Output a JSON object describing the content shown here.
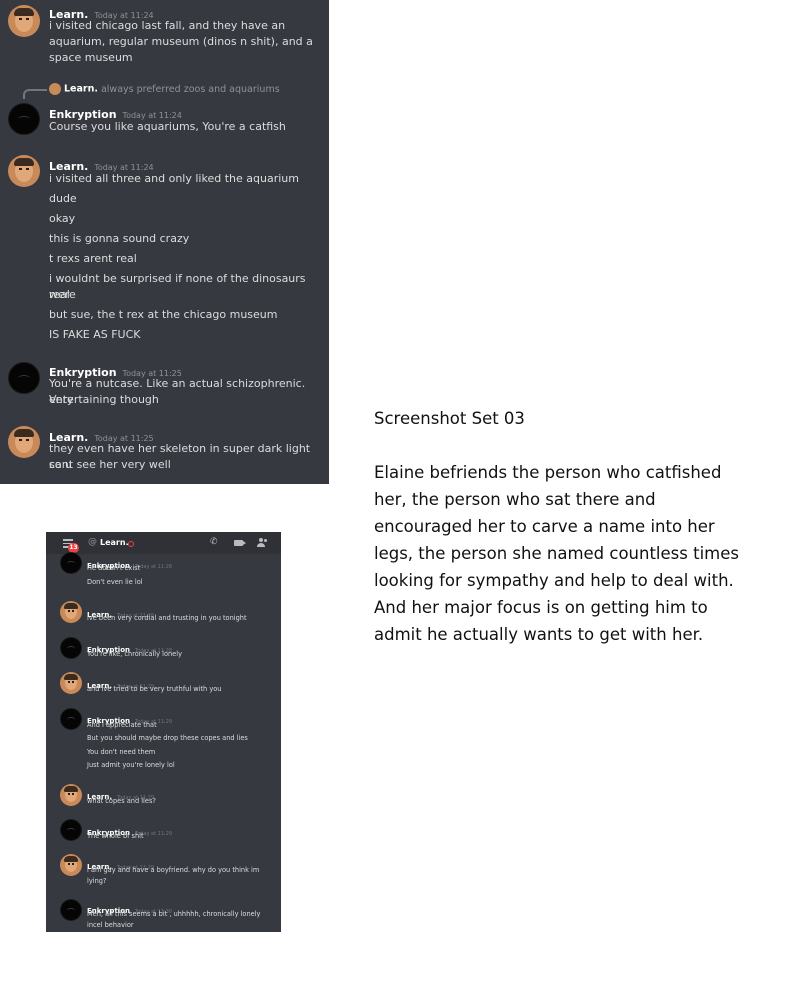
{
  "panel1": {
    "messages": [
      {
        "author": "Learn.",
        "time": "Today at 11:24",
        "lines": [
          "i visited chicago last fall, and they have an",
          "aquarium, regular museum (dinos n shit), and a",
          "space museum"
        ]
      },
      {
        "reply_author": "Learn.",
        "reply_text": "always preferred zoos and aquariums",
        "author": "Enkryption",
        "time": "Today at 11:24",
        "lines": [
          "Course you like aquariums, You're a catfish"
        ]
      },
      {
        "author": "Learn.",
        "time": "Today at 11:24",
        "lines": [
          "i visited all three and only liked the aquarium",
          "dude",
          "okay",
          "this is gonna sound crazy",
          "t rexs arent real",
          "i wouldnt be surprised if none of the dinosaurs were",
          "real",
          "but sue, the t rex at the chicago museum",
          "IS FAKE AS FUCK"
        ]
      },
      {
        "author": "Enkryption",
        "time": "Today at 11:25",
        "lines": [
          "You're a nutcase. Like an actual schizophrenic. Very",
          "entertaining though"
        ]
      },
      {
        "author": "Learn.",
        "time": "Today at 11:25",
        "lines": [
          "they even have her skeleton in super dark light so u",
          "cant see her very well"
        ]
      }
    ]
  },
  "caption": {
    "title": "Screenshot Set 03",
    "lines": [
      "Elaine befriends the person who catfished",
      "her, the person who sat there and",
      "encouraged her to carve a name into her",
      "legs, the person she named countless times",
      "looking for sympathy and help to deal with.",
      "And her major focus is on getting him to",
      "admit he actually wants to get with her."
    ]
  },
  "panel2": {
    "topbar": {
      "badge": "13",
      "at": "@",
      "channel": "Learn."
    },
    "messages": [
      {
        "author": "Enkryption",
        "time": "Today at 11:28",
        "lines": [
          "He doesn't exist",
          "Don't even lie lol"
        ]
      },
      {
        "author": "Learn.",
        "time": "Today at 11:28",
        "lines": [
          "ive been very cordial and trusting in you tonight"
        ]
      },
      {
        "author": "Enkryption",
        "time": "Today at 11:28",
        "lines": [
          "You're like, chronically lonely"
        ]
      },
      {
        "author": "Learn.",
        "time": "Today at 11:29",
        "lines": [
          "and ive tried to be very truthful with you"
        ]
      },
      {
        "author": "Enkryption",
        "time": "Today at 11:29",
        "lines": [
          "And I appreciate that",
          "But you should maybe drop these copes and lies",
          "You don't need them",
          "Just admit you're lonely lol"
        ]
      },
      {
        "author": "Learn.",
        "time": "Today at 11:29",
        "lines": [
          "what copes and lies?"
        ]
      },
      {
        "author": "Enkryption",
        "time": "Today at 11:29",
        "lines": [
          "The whole bf shit"
        ]
      },
      {
        "author": "Learn.",
        "time": "Today at 11:29",
        "lines": [
          "i am gay and have a boyfriend. why do you think im",
          "lying?"
        ]
      },
      {
        "author": "Enkryption",
        "time": "Today at 11:30",
        "lines": [
          "Meh, all this seems a bit , uhhhhh, chronically lonely",
          "incel behavior"
        ]
      }
    ]
  },
  "colors": {
    "chat_bg": "#36393f",
    "topbar_bg": "#2f3136",
    "text": "#dcddde",
    "timestamp": "#8e9297",
    "badge": "#ed4245"
  }
}
